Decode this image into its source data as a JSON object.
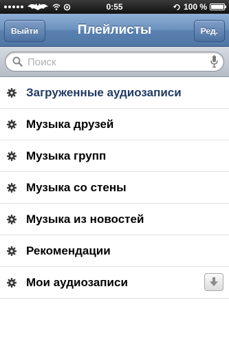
{
  "status_bar": {
    "time": "0:55",
    "battery": "100 %",
    "battery_level": 1.0,
    "carrier_logo_icon": "bat-logo-icon"
  },
  "nav": {
    "title": "Плейлисты",
    "left_button": "Выйти",
    "right_button": "Ред."
  },
  "search": {
    "placeholder": "Поиск"
  },
  "playlists": [
    {
      "label": "Загруженные аудиозаписи",
      "icon": "gear-icon",
      "active": true
    },
    {
      "label": "Музыка друзей",
      "icon": "gear-icon"
    },
    {
      "label": "Музыка групп",
      "icon": "gear-icon"
    },
    {
      "label": "Музыка со стены",
      "icon": "gear-icon"
    },
    {
      "label": "Музыка из новостей",
      "icon": "gear-icon"
    },
    {
      "label": "Рекомендации",
      "icon": "gear-icon"
    },
    {
      "label": "Мои аудиозаписи",
      "icon": "gear-icon",
      "action_icon": "download-icon"
    }
  ],
  "colors": {
    "nav_bar": "#6a90bd",
    "active_label": "#223a63"
  }
}
